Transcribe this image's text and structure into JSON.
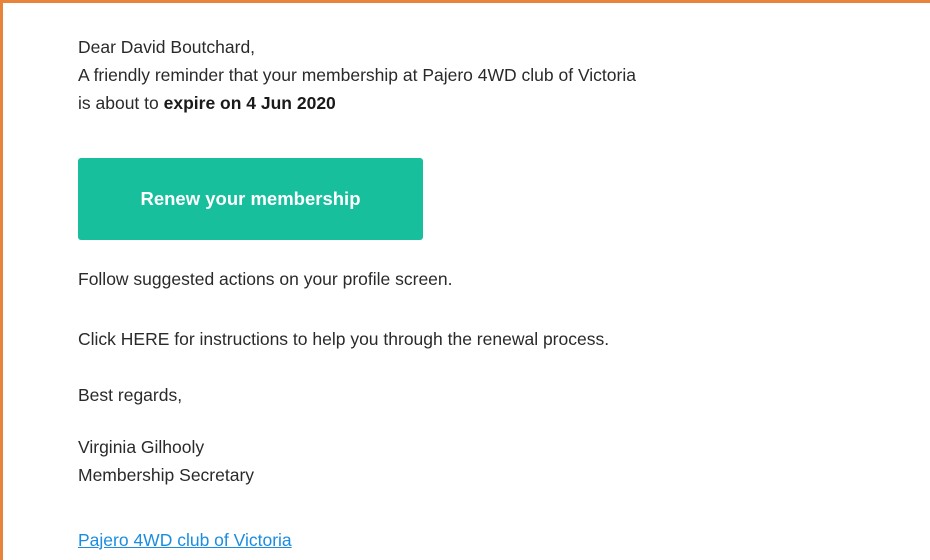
{
  "email": {
    "greeting": "Dear David Boutchard,",
    "reminder_line1": "A friendly reminder that your membership at Pajero 4WD club of Victoria",
    "reminder_line2_prefix": "is about to ",
    "reminder_line2_emphasis": "expire on 4 Jun 2020",
    "renew_button_label": "Renew your membership",
    "follow_text": "Follow suggested actions on your profile screen.",
    "click_here_text": "Click HERE for instructions to help you through the renewal process.",
    "closing": "Best regards,",
    "signature_name": "Virginia Gilhooly",
    "signature_title": "Membership Secretary",
    "club_link_text": "Pajero 4WD club of Victoria"
  },
  "colors": {
    "border_accent": "#e8843a",
    "button_bg": "#17bf9c",
    "link": "#1a8de0"
  }
}
